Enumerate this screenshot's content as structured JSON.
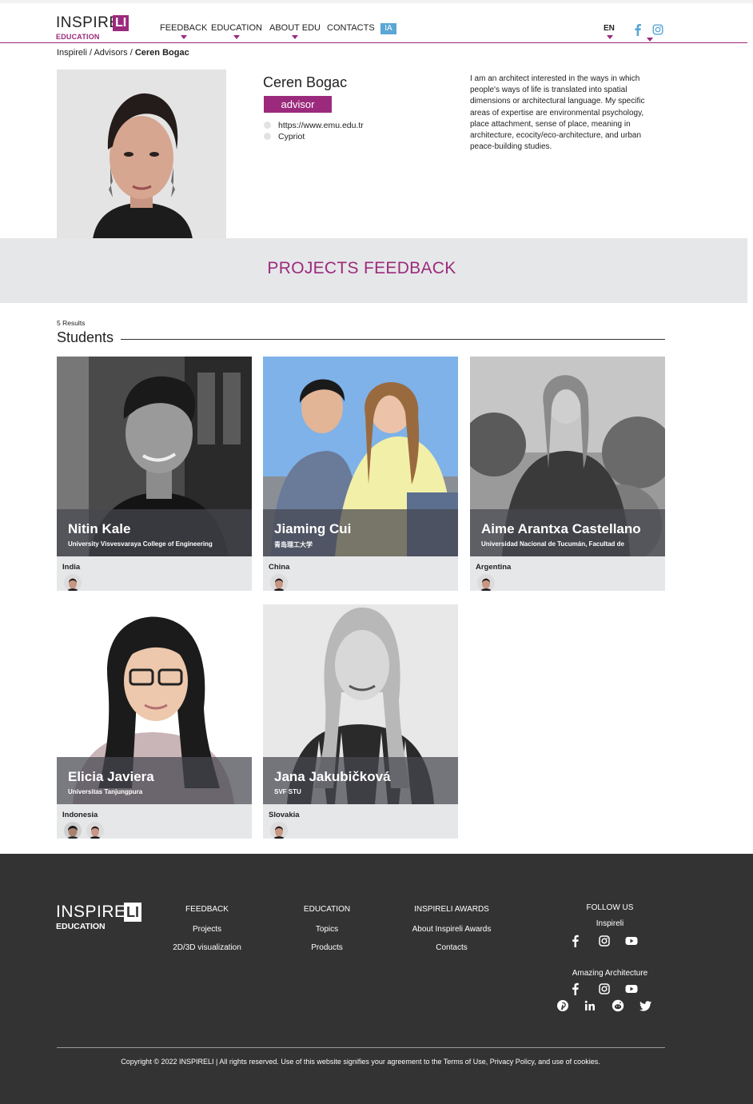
{
  "header": {
    "logo_word": "INSPIRE",
    "logo_mark": "LI",
    "logo_sub": "EDUCATION",
    "nav": [
      {
        "label": "FEEDBACK",
        "has_dropdown": true
      },
      {
        "label": "EDUCATION",
        "has_dropdown": true
      },
      {
        "label": "ABOUT EDU",
        "has_dropdown": true
      },
      {
        "label": "CONTACTS",
        "has_dropdown": false
      }
    ],
    "ia_badge": "IA",
    "language": "EN",
    "icons": [
      "facebook-icon",
      "instagram-icon"
    ],
    "accent_color": "#9b2a7c",
    "ia_color": "#5aa6d6"
  },
  "breadcrumb": {
    "items": [
      "Inspireli",
      "Advisors"
    ],
    "separator": " / ",
    "current": "Ceren Bogac"
  },
  "profile": {
    "name": "Ceren Bogac",
    "role": "advisor",
    "website": "https://www.emu.edu.tr",
    "nationality": "Cypriot",
    "bio": "I am an architect interested in the ways in which people's ways of life is translated into spatial dimensions or architectural language. My specific areas of expertise are environmental psychology, place attachment, sense of place, meaning in architecture, ecocity/eco-architecture, and urban peace-building studies."
  },
  "projects": {
    "section_title": "PROJECTS FEEDBACK",
    "results": "5 Results",
    "list_title": "Students",
    "students": [
      {
        "name": "Nitin Kale",
        "university": "University Visvesvaraya College of Engineering",
        "country": "India",
        "advisor_count": 1
      },
      {
        "name": "Jiaming Cui",
        "university": "青岛理工大学",
        "country": "China",
        "advisor_count": 1
      },
      {
        "name": "Aime Arantxa Castellano",
        "university": "Universidad Nacional de Tucumán, Facultad de",
        "country": "Argentina",
        "advisor_count": 1
      },
      {
        "name": "Elicia Javiera",
        "university": "Universitas Tanjungpura",
        "country": "Indonesia",
        "advisor_count": 2
      },
      {
        "name": "Jana Jakubičková",
        "university": "SVF STU",
        "country": "Slovakia",
        "advisor_count": 1
      }
    ]
  },
  "footer": {
    "logo_word": "INSPIRE",
    "logo_mark": "LI",
    "logo_sub": "EDUCATION",
    "columns": [
      {
        "heading": "FEEDBACK",
        "links": [
          "Projects",
          "2D/3D visualization"
        ]
      },
      {
        "heading": "EDUCATION",
        "links": [
          "Topics",
          "Products"
        ]
      },
      {
        "heading": "INSPIRELI AWARDS",
        "links": [
          "About Inspireli Awards",
          "Contacts"
        ]
      }
    ],
    "follow_heading": "FOLLOW US",
    "follow_groups": [
      {
        "name": "Inspireli",
        "icons": [
          "facebook-icon",
          "instagram-icon",
          "youtube-icon"
        ]
      },
      {
        "name": "Amazing Architecture",
        "icons": [
          "facebook-icon",
          "instagram-icon",
          "youtube-icon",
          "pinterest-icon",
          "linkedin-icon",
          "reddit-icon",
          "twitter-icon"
        ]
      }
    ],
    "copyright": "Copyright © 2022 INSPIRELI | All rights reserved. Use of this website signifies your agreement to the Terms of Use, Privacy Policy, and use of cookies.",
    "background": "#333333"
  }
}
